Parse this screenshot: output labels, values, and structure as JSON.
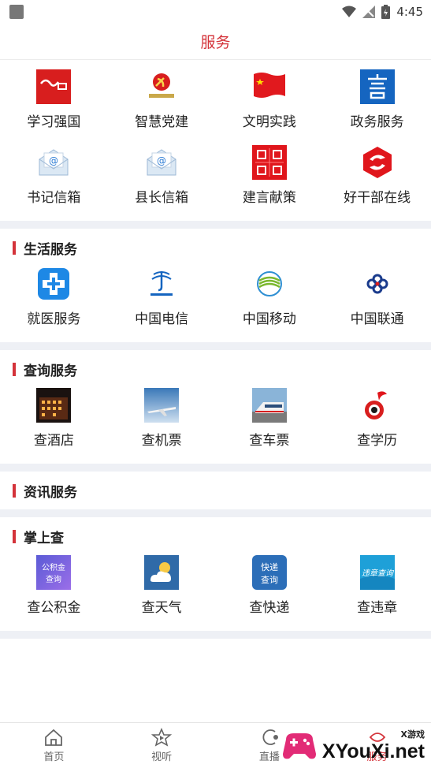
{
  "status_bar": {
    "time": "4:45"
  },
  "header": {
    "title": "服务"
  },
  "top_services": [
    {
      "label": "学习强国",
      "icon": "xuexi-qiangguo-icon"
    },
    {
      "label": "智慧党建",
      "icon": "party-building-icon"
    },
    {
      "label": "文明实践",
      "icon": "red-flag-icon"
    },
    {
      "label": "政务服务",
      "icon": "gov-service-icon"
    },
    {
      "label": "书记信箱",
      "icon": "envelope-icon"
    },
    {
      "label": "县长信箱",
      "icon": "envelope-icon"
    },
    {
      "label": "建言献策",
      "icon": "suggestion-icon"
    },
    {
      "label": "好干部在线",
      "icon": "good-cadre-icon"
    }
  ],
  "sections": [
    {
      "title": "生活服务",
      "items": [
        {
          "label": "就医服务",
          "icon": "medical-cross-icon"
        },
        {
          "label": "中国电信",
          "icon": "china-telecom-icon"
        },
        {
          "label": "中国移动",
          "icon": "china-mobile-icon"
        },
        {
          "label": "中国联通",
          "icon": "china-unicom-icon"
        }
      ]
    },
    {
      "title": "查询服务",
      "items": [
        {
          "label": "查酒店",
          "icon": "hotel-icon"
        },
        {
          "label": "查机票",
          "icon": "airplane-icon"
        },
        {
          "label": "查车票",
          "icon": "train-icon"
        },
        {
          "label": "查学历",
          "icon": "education-icon"
        }
      ]
    },
    {
      "title": "资讯服务",
      "items": []
    },
    {
      "title": "掌上查",
      "items": [
        {
          "label": "查公积金",
          "icon": "housing-fund-icon",
          "icon_text": "公积金查询"
        },
        {
          "label": "查天气",
          "icon": "weather-icon"
        },
        {
          "label": "查快递",
          "icon": "express-icon",
          "icon_text": "快递查询"
        },
        {
          "label": "查违章",
          "icon": "violation-icon",
          "icon_text": "违章查询"
        }
      ]
    }
  ],
  "bottom_nav": [
    {
      "label": "首页",
      "icon": "home-icon"
    },
    {
      "label": "视听",
      "icon": "media-icon"
    },
    {
      "label": "直播",
      "icon": "live-icon"
    },
    {
      "label": "服务",
      "icon": "service-icon",
      "active": true
    }
  ],
  "watermark": {
    "small": "X游戏",
    "big": "XYouXi.net"
  },
  "colors": {
    "accent": "#d4333a",
    "divider": "#eef0f5"
  }
}
